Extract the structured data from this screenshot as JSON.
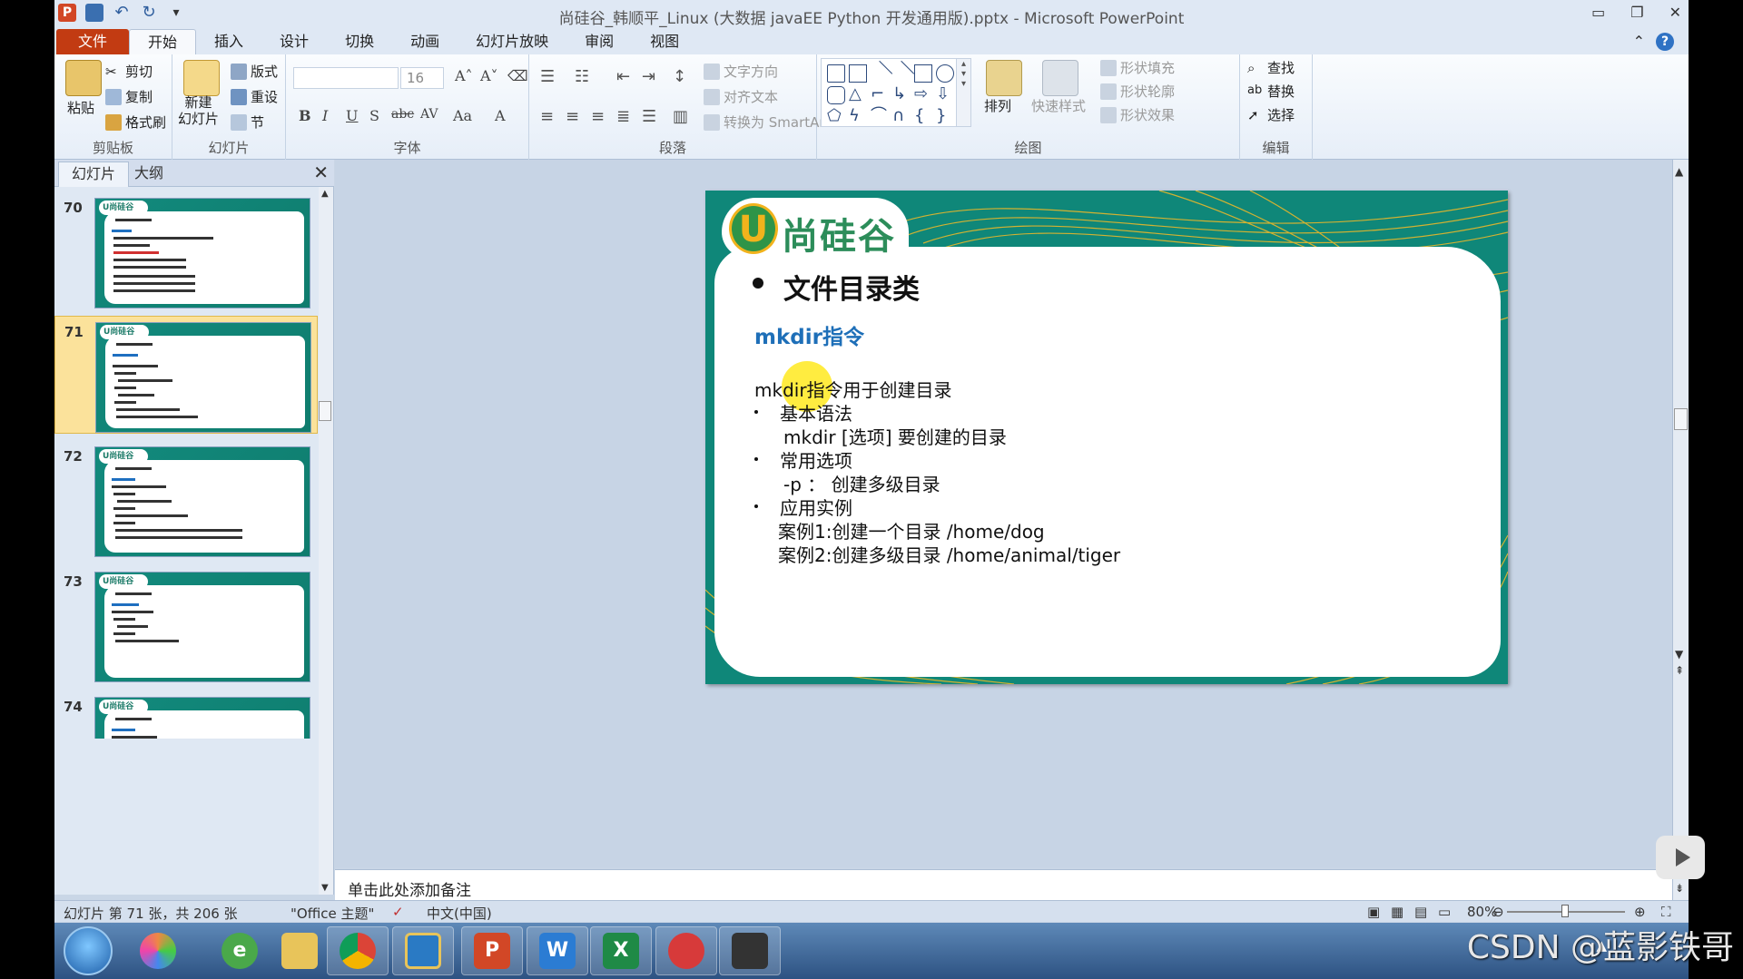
{
  "window": {
    "title": "尚硅谷_韩顺平_Linux (大数据 javaEE Python 开发通用版).pptx - Microsoft PowerPoint",
    "ppt_logo": "P"
  },
  "tabs": [
    {
      "label": "文件"
    },
    {
      "label": "开始"
    },
    {
      "label": "插入"
    },
    {
      "label": "设计"
    },
    {
      "label": "切换"
    },
    {
      "label": "动画"
    },
    {
      "label": "幻灯片放映"
    },
    {
      "label": "审阅"
    },
    {
      "label": "视图"
    }
  ],
  "help_label": "?",
  "ribbon": {
    "clipboard": {
      "label": "剪贴板",
      "paste": "粘贴",
      "cut": "剪切",
      "copy": "复制",
      "format_painter": "格式刷"
    },
    "slides": {
      "label": "幻灯片",
      "new_slide": "新建\n幻灯片",
      "layout": "版式",
      "reset": "重设",
      "section": "节"
    },
    "font": {
      "label": "字体",
      "font_name": "",
      "font_size": "16",
      "bold": "B",
      "italic": "I",
      "underline": "U",
      "shadow": "S",
      "strike": "abc",
      "spacing": "AV",
      "case": "Aa",
      "color": "A"
    },
    "paragraph": {
      "label": "段落",
      "text_direction": "文字方向",
      "align_text": "对齐文本",
      "smartart": "转换为 SmartArt"
    },
    "drawing": {
      "label": "绘图",
      "arrange": "排列",
      "quick_styles": "快速样式",
      "shape_fill": "形状填充",
      "shape_outline": "形状轮廓",
      "shape_effects": "形状效果"
    },
    "editing": {
      "label": "编辑",
      "find": "查找",
      "replace": "替换",
      "select": "选择"
    }
  },
  "left_panel": {
    "tabs": [
      "幻灯片",
      "大纲"
    ],
    "close": "✕",
    "thumbnails": [
      {
        "num": "70",
        "logo": "U尚硅谷",
        "selected": false
      },
      {
        "num": "71",
        "logo": "U尚硅谷",
        "selected": true
      },
      {
        "num": "72",
        "logo": "U尚硅谷",
        "selected": false
      },
      {
        "num": "73",
        "logo": "U尚硅谷",
        "selected": false
      },
      {
        "num": "74",
        "logo": "U尚硅谷",
        "selected": false
      }
    ]
  },
  "slide": {
    "logo_letter": "U",
    "logo_text": "尚硅谷",
    "title": "文件目录类",
    "subtitle": "mkdir指令",
    "lines": [
      "mkdir指令用于创建目录",
      "基本语法",
      "mkdir  [选项]  要创建的目录",
      "常用选项",
      "-p ：  创建多级目录",
      "应用实例",
      "案例1:创建一个目录 /home/dog",
      "案例2:创建多级目录 /home/animal/tiger"
    ]
  },
  "notes": {
    "placeholder": "单击此处添加备注"
  },
  "status": {
    "slide_info": "幻灯片 第 71 张，共 206 张",
    "theme": "\"Office 主题\"",
    "language": "中文(中国)",
    "zoom": "80%"
  },
  "taskbar": {
    "apps": [
      "Windows",
      "相册",
      "360",
      "文件夹",
      "Chrome",
      "虚拟机",
      "PowerPoint",
      "Word",
      "Excel",
      "录屏",
      "摄像"
    ]
  },
  "watermark": "CSDN @蓝影铁哥",
  "colors": {
    "slide_bg": "#0f8779",
    "subtitle_blue": "#1e6fb8",
    "file_tab": "#c23b12",
    "selected_thumb": "#fbe29b"
  }
}
